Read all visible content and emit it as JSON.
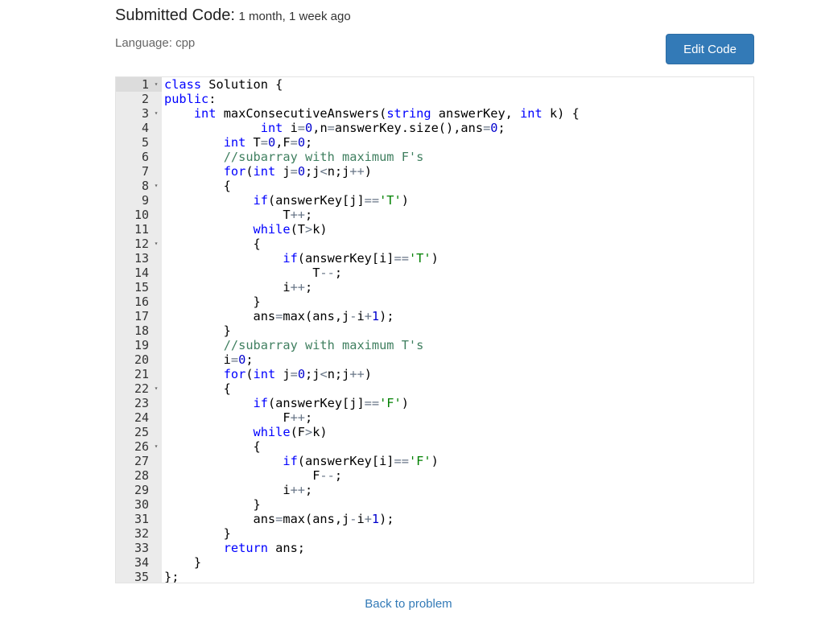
{
  "header": {
    "title": "Submitted Code:",
    "time": "1 month, 1 week ago",
    "language": "Language: cpp"
  },
  "actions": {
    "edit_label": "Edit Code",
    "back_label": "Back to problem"
  },
  "code": {
    "lines": [
      {
        "n": "1",
        "fold": true,
        "text": "class Solution {"
      },
      {
        "n": "2",
        "fold": false,
        "text": "public:"
      },
      {
        "n": "3",
        "fold": true,
        "text": "    int maxConsecutiveAnswers(string answerKey, int k) {"
      },
      {
        "n": "4",
        "fold": false,
        "text": "             int i=0,n=answerKey.size(),ans=0;"
      },
      {
        "n": "5",
        "fold": false,
        "text": "        int T=0,F=0;"
      },
      {
        "n": "6",
        "fold": false,
        "text": "        //subarray with maximum F's"
      },
      {
        "n": "7",
        "fold": false,
        "text": "        for(int j=0;j<n;j++)"
      },
      {
        "n": "8",
        "fold": true,
        "text": "        {"
      },
      {
        "n": "9",
        "fold": false,
        "text": "            if(answerKey[j]=='T')"
      },
      {
        "n": "10",
        "fold": false,
        "text": "                T++;"
      },
      {
        "n": "11",
        "fold": false,
        "text": "            while(T>k)"
      },
      {
        "n": "12",
        "fold": true,
        "text": "            {"
      },
      {
        "n": "13",
        "fold": false,
        "text": "                if(answerKey[i]=='T')"
      },
      {
        "n": "14",
        "fold": false,
        "text": "                    T--;"
      },
      {
        "n": "15",
        "fold": false,
        "text": "                i++;"
      },
      {
        "n": "16",
        "fold": false,
        "text": "            }"
      },
      {
        "n": "17",
        "fold": false,
        "text": "            ans=max(ans,j-i+1);"
      },
      {
        "n": "18",
        "fold": false,
        "text": "        }"
      },
      {
        "n": "19",
        "fold": false,
        "text": "        //subarray with maximum T's"
      },
      {
        "n": "20",
        "fold": false,
        "text": "        i=0;"
      },
      {
        "n": "21",
        "fold": false,
        "text": "        for(int j=0;j<n;j++)"
      },
      {
        "n": "22",
        "fold": true,
        "text": "        {"
      },
      {
        "n": "23",
        "fold": false,
        "text": "            if(answerKey[j]=='F')"
      },
      {
        "n": "24",
        "fold": false,
        "text": "                F++;"
      },
      {
        "n": "25",
        "fold": false,
        "text": "            while(F>k)"
      },
      {
        "n": "26",
        "fold": true,
        "text": "            {"
      },
      {
        "n": "27",
        "fold": false,
        "text": "                if(answerKey[i]=='F')"
      },
      {
        "n": "28",
        "fold": false,
        "text": "                    F--;"
      },
      {
        "n": "29",
        "fold": false,
        "text": "                i++;"
      },
      {
        "n": "30",
        "fold": false,
        "text": "            }"
      },
      {
        "n": "31",
        "fold": false,
        "text": "            ans=max(ans,j-i+1);"
      },
      {
        "n": "32",
        "fold": false,
        "text": "        }"
      },
      {
        "n": "33",
        "fold": false,
        "text": "        return ans;"
      },
      {
        "n": "34",
        "fold": false,
        "text": "    }"
      },
      {
        "n": "35",
        "fold": false,
        "text": "};"
      }
    ]
  },
  "colors": {
    "accent": "#337ab7",
    "keyword": "#0000ff",
    "comment": "#3f7f5f",
    "string": "#008000"
  }
}
